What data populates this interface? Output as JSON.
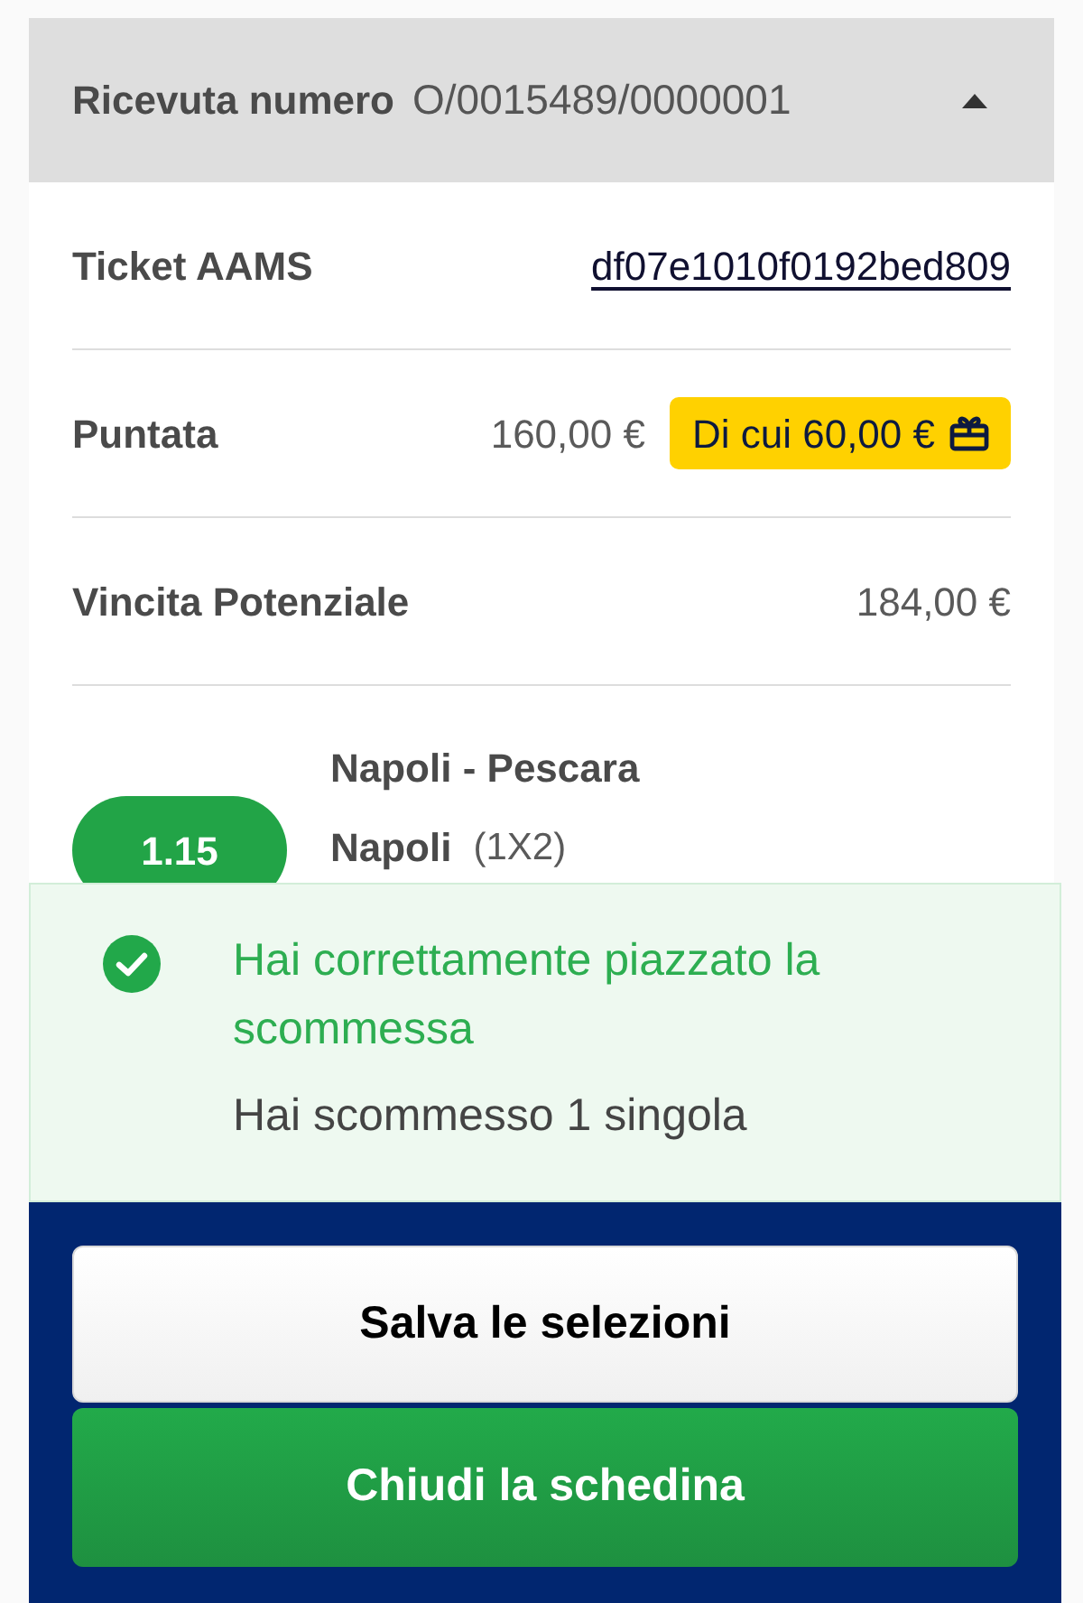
{
  "receipt_header": {
    "label": "Ricevuta numero",
    "number": "O/0015489/0000001",
    "expanded": true
  },
  "details": [
    {
      "kind": "link",
      "label": "Ticket AAMS",
      "value": "df07e1010f0192bed809"
    },
    {
      "kind": "amount",
      "label": "Puntata",
      "value": "160,00 €",
      "badge": "Di cui 60,00 €"
    },
    {
      "kind": "amount",
      "label": "Vincita Potenziale",
      "value": "184,00 €"
    }
  ],
  "selection": {
    "odds": "1.15",
    "event": "Napoli - Pescara",
    "pick": "Napoli",
    "market": "(1X2)"
  },
  "notification": {
    "title": "Hai correttamente piazzato la scommessa",
    "message": "Hai scommesso 1 singola"
  },
  "buttons": [
    {
      "kind": "secondary",
      "label": "Salva le selezioni"
    },
    {
      "kind": "primary",
      "label": "Chiudi la schedina"
    }
  ]
}
